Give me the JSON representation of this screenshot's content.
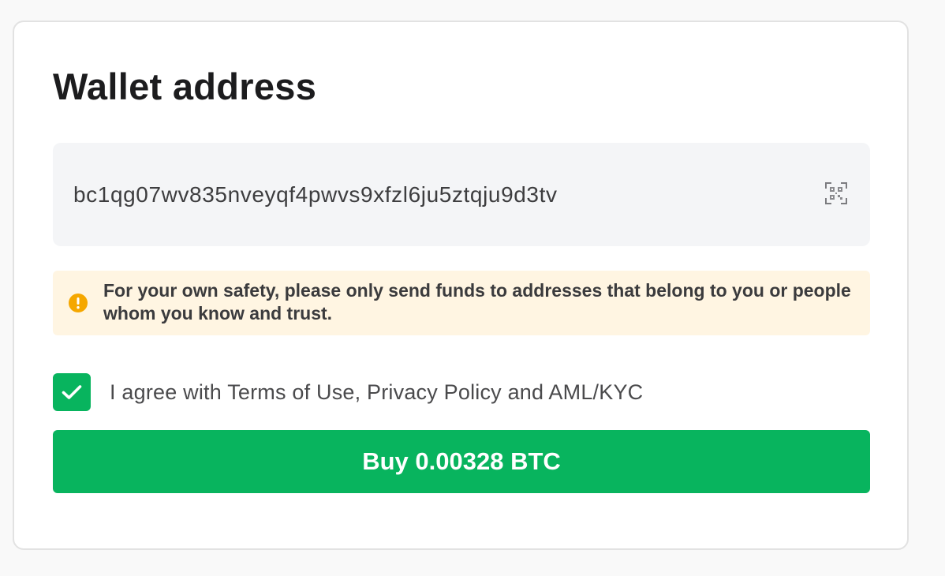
{
  "wallet": {
    "title": "Wallet address",
    "address_value": "bc1qg07wv835nveyqf4pwvs9xfzl6ju5ztqju9d3tv",
    "scan_icon": "qr-scan-icon"
  },
  "warning": {
    "icon": "exclamation-circle-icon",
    "text": "For your own safety, please only send funds to addresses that belong to you or people whom you know and trust."
  },
  "agreement": {
    "checked": true,
    "label": "I agree with Terms of Use, Privacy Policy and AML/KYC"
  },
  "buy_button": {
    "label": "Buy 0.00328 BTC"
  },
  "colors": {
    "accent_green": "#08b45e",
    "warning_bg": "#fff5e2",
    "warning_icon": "#f5a700",
    "field_bg": "#f4f5f7"
  }
}
